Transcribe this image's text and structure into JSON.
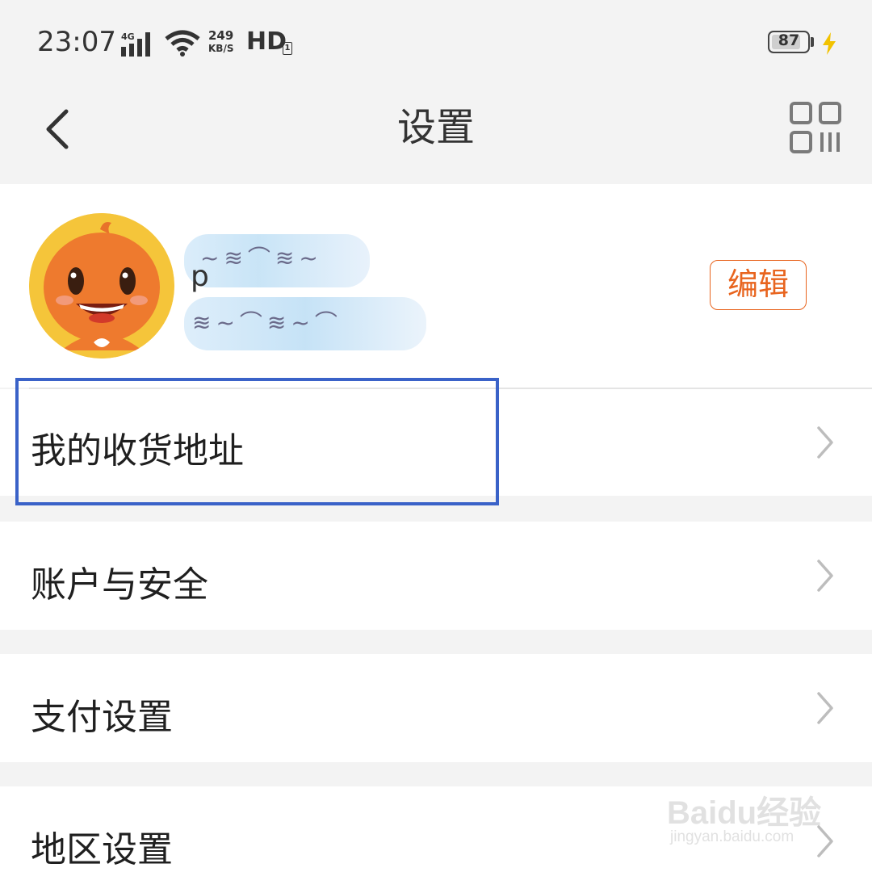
{
  "status_bar": {
    "time": "23:07",
    "network": "4G",
    "speed_value": "249",
    "speed_unit": "KB/S",
    "hd": "HD",
    "hd_sub": "1",
    "battery": "87",
    "battery_level": 0.87
  },
  "nav": {
    "title": "设置",
    "back_icon": "chevron-left-icon",
    "qr_icon": "qr-code-icon"
  },
  "profile": {
    "name_visible": "p",
    "edit_label": "编辑"
  },
  "menu": {
    "items": [
      {
        "label": "我的收货地址"
      },
      {
        "label": "账户与安全"
      },
      {
        "label": "支付设置"
      },
      {
        "label": "地区设置"
      }
    ]
  },
  "watermark": {
    "logo": "Baidu经验",
    "url": "jingyan.baidu.com"
  },
  "colors": {
    "accent": "#e8641e",
    "highlight": "#3a62c8",
    "background": "#f3f3f3"
  }
}
